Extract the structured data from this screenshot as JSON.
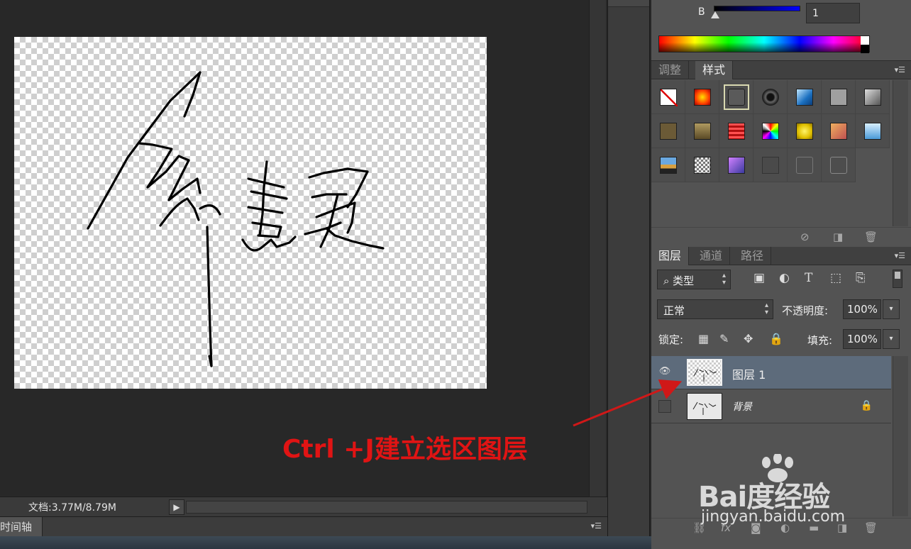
{
  "status": {
    "doc_info": "文档:3.77M/8.79M",
    "arrow": "▶"
  },
  "timeline": {
    "tab_label": "时间轴",
    "menu": "▾☰"
  },
  "color_panel": {
    "channel_label": "B",
    "channel_value": "1",
    "slider_level": 0.0
  },
  "styles_tabs": [
    {
      "label": "调整",
      "active": false
    },
    {
      "label": "样式",
      "active": true
    }
  ],
  "panel_menu_icon": "▾☰",
  "styles_footer": {
    "icons": [
      "no-style-icon",
      "new-style-icon",
      "delete-style-icon"
    ]
  },
  "layers_tabs": [
    {
      "label": "图层",
      "active": true
    },
    {
      "label": "通道",
      "active": false
    },
    {
      "label": "路径",
      "active": false
    }
  ],
  "layers": {
    "filter_type": "类型",
    "filter_icons": [
      "pixel-filter-icon",
      "adjustment-filter-icon",
      "type-filter-icon",
      "shape-filter-icon",
      "smart-object-filter-icon"
    ],
    "blend_mode": "正常",
    "opacity_label": "不透明度:",
    "opacity_value": "100%",
    "lock_label": "锁定:",
    "fill_label": "填充:",
    "fill_value": "100%",
    "items": [
      {
        "name": "图层 1",
        "selected": true,
        "visible": true,
        "locked": false
      },
      {
        "name": "背景",
        "selected": false,
        "visible": false,
        "locked": true
      }
    ]
  },
  "annotation": {
    "text": "Ctrl +J建立选区图层",
    "color": "#e01414"
  },
  "watermark": {
    "logo": "Bai度经验",
    "url": "jingyan.baidu.com"
  },
  "colors": {
    "panel_bg": "#535353",
    "canvas_bg": "#282828",
    "selected_layer": "#5d6b7b"
  }
}
